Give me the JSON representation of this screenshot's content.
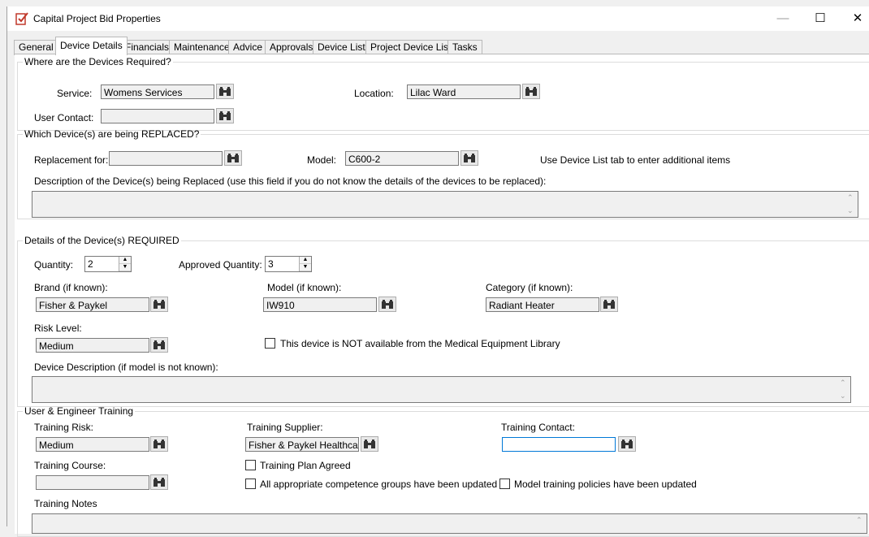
{
  "window": {
    "title": "Capital Project Bid Properties"
  },
  "titlebar_buttons": {
    "minimize": "—",
    "maximize": "☐",
    "close": "✕"
  },
  "tabs": [
    "General",
    "Device Details",
    "Financials",
    "Maintenance",
    "Advice",
    "Approvals",
    "Device List",
    "Project Device List",
    "Tasks"
  ],
  "where": {
    "legend": "Where are the Devices Required?",
    "service_label": "Service:",
    "service_value": "Womens Services",
    "location_label": "Location:",
    "location_value": "Lilac Ward",
    "user_contact_label": "User Contact:",
    "user_contact_value": ""
  },
  "replaced": {
    "legend": "Which Device(s) are being REPLACED?",
    "replacement_label": "Replacement for:",
    "replacement_value": "",
    "model_label": "Model:",
    "model_value": "C600-2",
    "hint": "Use Device List tab to enter additional items",
    "description_label": "Description of the Device(s) being Replaced (use this field if you do not know the details of the devices to be replaced):",
    "description_value": ""
  },
  "required": {
    "legend": "Details of the Device(s) REQUIRED",
    "quantity_label": "Quantity:",
    "quantity_value": "2",
    "approved_label": "Approved Quantity:",
    "approved_value": "3",
    "brand_label": "Brand (if known):",
    "brand_value": "Fisher & Paykel",
    "model_label": "Model  (if known):",
    "model_value": "IW910",
    "category_label": "Category  (if known):",
    "category_value": "Radiant Heater",
    "risk_label": "Risk Level:",
    "risk_value": "Medium",
    "not_available_label": "This device is NOT available from the Medical Equipment Library",
    "not_available_checked": false,
    "description_label": "Device Description (if model is not known):",
    "description_value": ""
  },
  "training": {
    "legend": "User & Engineer Training",
    "risk_label": "Training Risk:",
    "risk_value": "Medium",
    "supplier_label": "Training Supplier:",
    "supplier_value": "Fisher & Paykel Healthcare",
    "contact_label": "Training Contact:",
    "contact_value": "",
    "course_label": "Training Course:",
    "course_value": "",
    "plan_agreed_label": "Training Plan Agreed",
    "competence_label": "All appropriate competence groups have been updated",
    "policies_label": "Model training policies have been updated",
    "notes_label": "Training Notes",
    "notes_value": ""
  },
  "icons": {
    "lookup": "binoculars-icon"
  },
  "colors": {
    "focus_border": "#0078d7",
    "field_bg": "#f0f0f0"
  }
}
